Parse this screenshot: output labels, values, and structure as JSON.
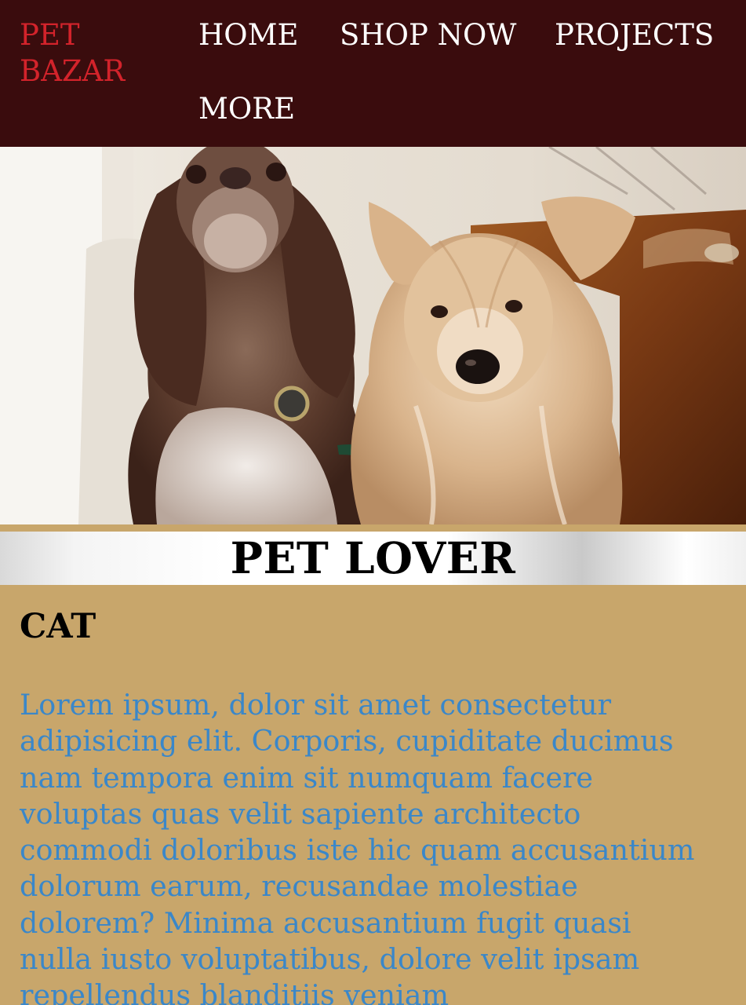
{
  "nav": {
    "brand": "PET BAZAR",
    "links": [
      "HOME",
      "SHOP NOW",
      "PROJECTS",
      "MORE"
    ]
  },
  "hero": {
    "image_description": "two dogs sitting side by side indoors"
  },
  "banner": {
    "title": "PET LOVER"
  },
  "section": {
    "heading": "CAT",
    "body": "Lorem ipsum, dolor sit amet consectetur adipisicing elit. Corporis, cupiditate ducimus nam tempora enim sit numquam facere voluptas quas velit sapiente architecto commodi doloribus iste hic quam accusantium dolorum earum, recusandae molestiae dolorem? Minima accusantium fugit quasi nulla iusto voluptatibus, dolore velit ipsam repellendus blanditiis veniam"
  },
  "colors": {
    "nav_bg": "#3a0c0d",
    "brand": "#d3232b",
    "content_bg": "#c8a66b",
    "body_text": "#3a87c9"
  }
}
